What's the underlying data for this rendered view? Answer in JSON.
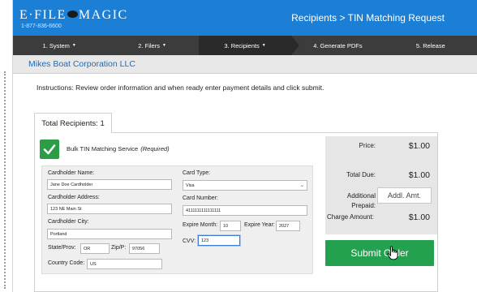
{
  "header": {
    "logo_left": "E·FILE",
    "logo_right": "MAGIC",
    "phone": "1-877-836-6600",
    "title": "Recipients > TIN Matching Request"
  },
  "steps": [
    {
      "label": "1. System",
      "caret": "▼"
    },
    {
      "label": "2. Filers",
      "caret": "▼"
    },
    {
      "label": "3. Recipients",
      "caret": "▼"
    },
    {
      "label": "4. Generate PDFs",
      "caret": ""
    },
    {
      "label": "5. Release",
      "caret": ""
    }
  ],
  "company_name": "Mikes Boat Corporation LLC",
  "instructions": "Instructions: Review order information and when ready enter payment details and click submit.",
  "tab": {
    "label": "Total Recipients: 1"
  },
  "service": {
    "name": "Bulk TIN Matching Service",
    "qualifier": "(Required)"
  },
  "form": {
    "cardholder_name_label": "Cardholder Name:",
    "cardholder_name": "Jane Doe Cardholder",
    "address_label": "Cardholder Address:",
    "address": "123 NE Main St",
    "city_label": "Cardholder City:",
    "city": "Portland",
    "state_label": "State/Prov:",
    "state": "OR",
    "zip_label": "Zip/P:",
    "zip": "97056",
    "country_label": "Country Code:",
    "country": "US",
    "card_type_label": "Card Type:",
    "card_type": "Visa",
    "card_number_label": "Card Number:",
    "card_number": "4111111111111111",
    "expire_month_label": "Expire Month:",
    "expire_month": "10",
    "expire_year_label": "Expire Year:",
    "expire_year": "2027",
    "cvv_label": "CVV:",
    "cvv": "123"
  },
  "summary": {
    "price_label": "Price:",
    "price": "$1.00",
    "total_due_label": "Total Due:",
    "total_due": "$1.00",
    "additional_label_1": "Additional",
    "additional_label_2": "Prepaid:",
    "additional_placeholder": "Addl. Amt.",
    "charge_label": "Charge Amount:",
    "charge": "$1.00"
  },
  "submit_label": "Submit Order",
  "colors": {
    "brand_blue": "#1c7fd6",
    "nav_dark": "#3c3c3c",
    "success_green": "#24a14f"
  }
}
